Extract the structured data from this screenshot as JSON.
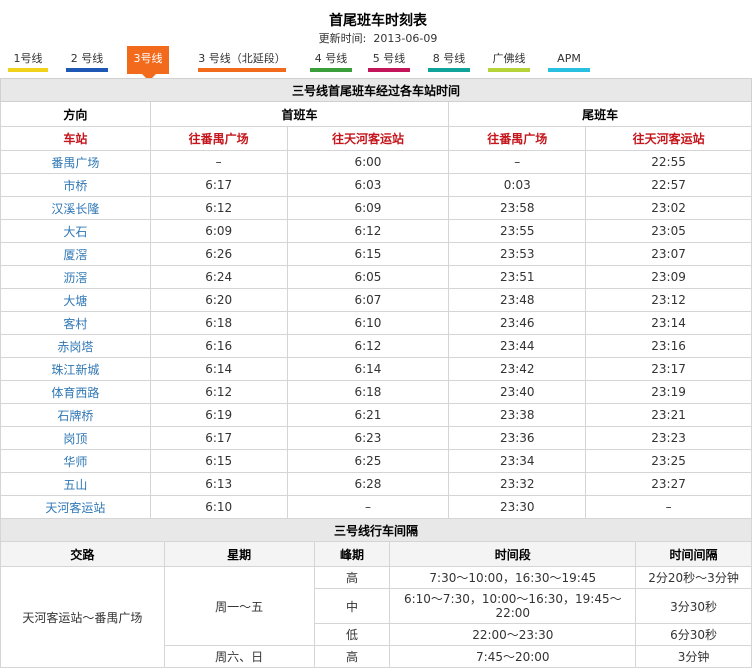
{
  "header": {
    "title": "首尾班车时刻表",
    "updated_label": "更新时间:",
    "updated_value": "2013-06-09"
  },
  "tabs": [
    {
      "label": "1号线",
      "color": "#f2d11b",
      "active": false
    },
    {
      "label": "2 号线",
      "color": "#1f57b5",
      "active": false
    },
    {
      "label": "3号线",
      "color": "#f26b1d",
      "active": true
    },
    {
      "label": "3 号线（北延段）",
      "color": "#f26b1d",
      "active": false
    },
    {
      "label": "4 号线",
      "color": "#3a9e3a",
      "active": false
    },
    {
      "label": "5 号线",
      "color": "#c4145a",
      "active": false
    },
    {
      "label": "8 号线",
      "color": "#0fa39a",
      "active": false
    },
    {
      "label": "广佛线",
      "color": "#b7d33a",
      "active": false
    },
    {
      "label": "APM",
      "color": "#27c0e0",
      "active": false
    }
  ],
  "schedule": {
    "caption": "三号线首尾班车经过各车站时间",
    "direction_label": "方向",
    "first_train_label": "首班车",
    "last_train_label": "尾班车",
    "station_label": "车站",
    "to_panyu": "往番禺广场",
    "to_tianhe": "往天河客运站",
    "rows": [
      {
        "station": "番禺广场",
        "first_panyu": "–",
        "first_tianhe": "6:00",
        "last_panyu": "–",
        "last_tianhe": "22:55"
      },
      {
        "station": "市桥",
        "first_panyu": "6:17",
        "first_tianhe": "6:03",
        "last_panyu": "0:03",
        "last_tianhe": "22:57"
      },
      {
        "station": "汉溪长隆",
        "first_panyu": "6:12",
        "first_tianhe": "6:09",
        "last_panyu": "23:58",
        "last_tianhe": "23:02"
      },
      {
        "station": "大石",
        "first_panyu": "6:09",
        "first_tianhe": "6:12",
        "last_panyu": "23:55",
        "last_tianhe": "23:05"
      },
      {
        "station": "厦滘",
        "first_panyu": "6:26",
        "first_tianhe": "6:15",
        "last_panyu": "23:53",
        "last_tianhe": "23:07"
      },
      {
        "station": "沥滘",
        "first_panyu": "6:24",
        "first_tianhe": "6:05",
        "last_panyu": "23:51",
        "last_tianhe": "23:09"
      },
      {
        "station": "大塘",
        "first_panyu": "6:20",
        "first_tianhe": "6:07",
        "last_panyu": "23:48",
        "last_tianhe": "23:12"
      },
      {
        "station": "客村",
        "first_panyu": "6:18",
        "first_tianhe": "6:10",
        "last_panyu": "23:46",
        "last_tianhe": "23:14"
      },
      {
        "station": "赤岗塔",
        "first_panyu": "6:16",
        "first_tianhe": "6:12",
        "last_panyu": "23:44",
        "last_tianhe": "23:16"
      },
      {
        "station": "珠江新城",
        "first_panyu": "6:14",
        "first_tianhe": "6:14",
        "last_panyu": "23:42",
        "last_tianhe": "23:17"
      },
      {
        "station": "体育西路",
        "first_panyu": "6:12",
        "first_tianhe": "6:18",
        "last_panyu": "23:40",
        "last_tianhe": "23:19"
      },
      {
        "station": "石牌桥",
        "first_panyu": "6:19",
        "first_tianhe": "6:21",
        "last_panyu": "23:38",
        "last_tianhe": "23:21"
      },
      {
        "station": "岗顶",
        "first_panyu": "6:17",
        "first_tianhe": "6:23",
        "last_panyu": "23:36",
        "last_tianhe": "23:23"
      },
      {
        "station": "华师",
        "first_panyu": "6:15",
        "first_tianhe": "6:25",
        "last_panyu": "23:34",
        "last_tianhe": "23:25"
      },
      {
        "station": "五山",
        "first_panyu": "6:13",
        "first_tianhe": "6:28",
        "last_panyu": "23:32",
        "last_tianhe": "23:27"
      },
      {
        "station": "天河客运站",
        "first_panyu": "6:10",
        "first_tianhe": "–",
        "last_panyu": "23:30",
        "last_tianhe": "–"
      }
    ]
  },
  "interval": {
    "caption": "三号线行车间隔",
    "col_route": "交路",
    "col_day": "星期",
    "col_peak": "峰期",
    "col_period": "时间段",
    "col_gap": "时间间隔",
    "route": "天河客运站～番禺广场",
    "weekday": "周一～五",
    "weekend": "周六、日",
    "rows": [
      {
        "peak": "高",
        "period": "7:30～10:00，16:30～19:45",
        "gap": "2分20秒～3分钟"
      },
      {
        "peak": "中",
        "period": "6:10～7:30，10:00～16:30，19:45～22:00",
        "gap": "3分30秒"
      },
      {
        "peak": "低",
        "period": "22:00～23:30",
        "gap": "6分30秒"
      },
      {
        "peak": "高",
        "period": "7:45～20:00",
        "gap": "3分钟"
      }
    ]
  }
}
